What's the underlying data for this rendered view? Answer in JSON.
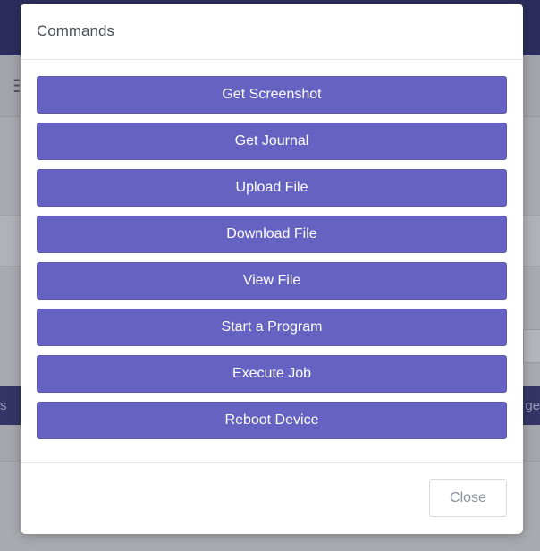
{
  "modal": {
    "title": "Commands",
    "commands": [
      "Get Screenshot",
      "Get Journal",
      "Upload File",
      "Download File",
      "View File",
      "Start a Program",
      "Execute Job",
      "Reboot Device"
    ],
    "close_label": "Close"
  },
  "background": {
    "left_fragment": "s",
    "right_fragment": "ge"
  },
  "colors": {
    "button_accent": "#6562c2",
    "topbar": "#2c2d5c"
  }
}
